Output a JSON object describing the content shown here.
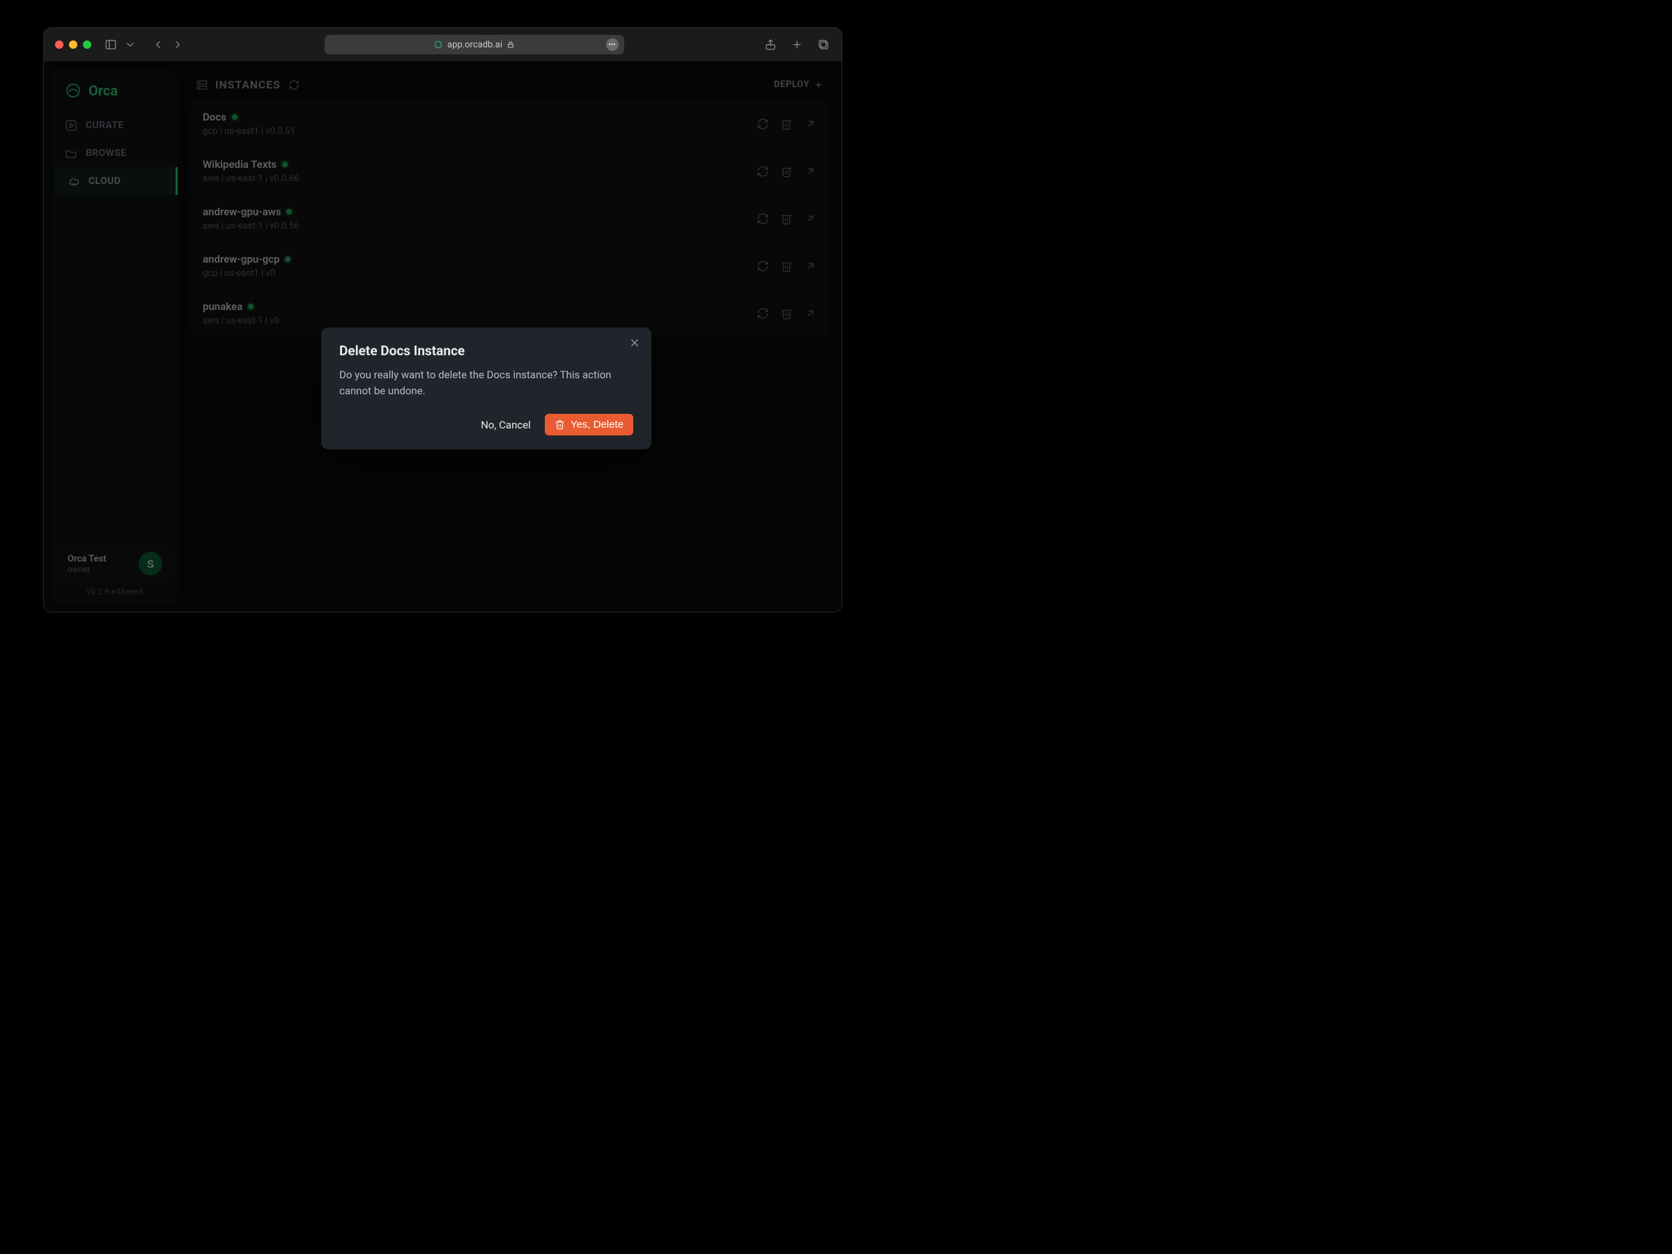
{
  "browser": {
    "address": "app.orcadb.ai"
  },
  "brand": {
    "name": "Orca"
  },
  "sidebar": {
    "items": [
      {
        "label": "CURATE"
      },
      {
        "label": "BROWSE"
      },
      {
        "label": "CLOUD"
      }
    ]
  },
  "account": {
    "name": "Orca Test",
    "role": "owner",
    "initial": "S"
  },
  "version": "v0.2.8-e48eee8",
  "page": {
    "title": "INSTANCES",
    "deploy_label": "DEPLOY"
  },
  "instances": [
    {
      "name": "Docs",
      "meta": "gcp | us-east1 | v0.0.61"
    },
    {
      "name": "Wikipedia Texts",
      "meta": "aws | us-east-1 | v0.0.66"
    },
    {
      "name": "andrew-gpu-aws",
      "meta": "aws | us-east-1 | v0.0.56"
    },
    {
      "name": "andrew-gpu-gcp",
      "meta": "gcp | us-east1 | v0"
    },
    {
      "name": "punakea",
      "meta": "aws | us-east-1 | v0"
    }
  ],
  "modal": {
    "title": "Delete Docs Instance",
    "body": "Do you really want to delete the Docs instance? This action cannot be undone.",
    "cancel": "No, Cancel",
    "confirm": "Yes, Delete"
  }
}
